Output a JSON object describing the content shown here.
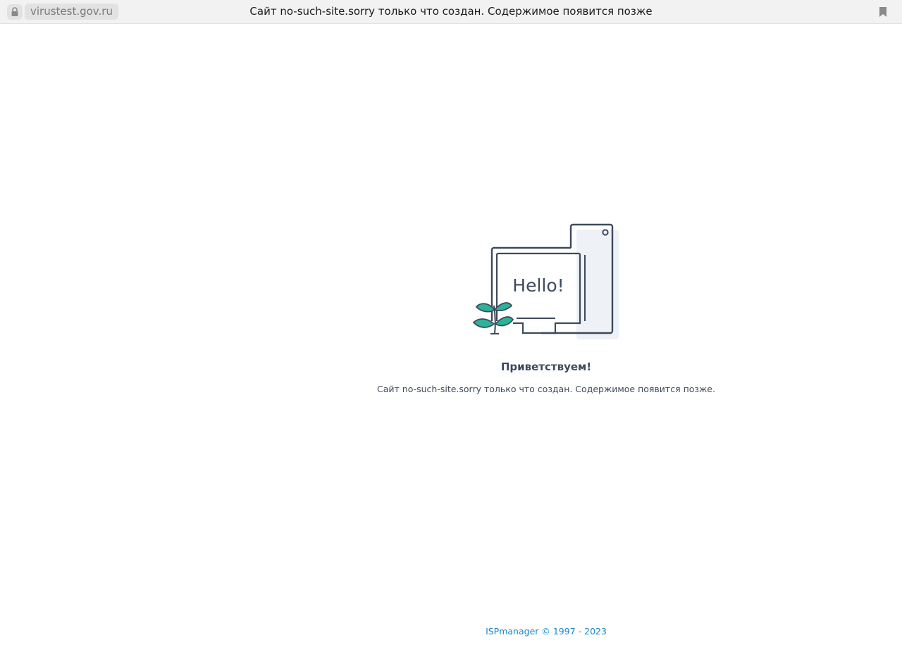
{
  "browser": {
    "url": "virustest.gov.ru",
    "tab_title": "Сайт no-such-site.sorry только что создан. Содержимое появится позже",
    "lock_icon": "lock-icon",
    "bookmark_icon": "bookmark-icon"
  },
  "page": {
    "illustration_text": "Hello!",
    "greeting": "Приветствуем!",
    "message": "Сайт no-such-site.sorry только что создан. Содержимое появится позже.",
    "footer": "ISPmanager © 1997 - 2023"
  },
  "colors": {
    "text": "#3d4a5c",
    "link": "#1a85c7",
    "leaf": "#2bb39a",
    "panel": "#eef2f6"
  }
}
